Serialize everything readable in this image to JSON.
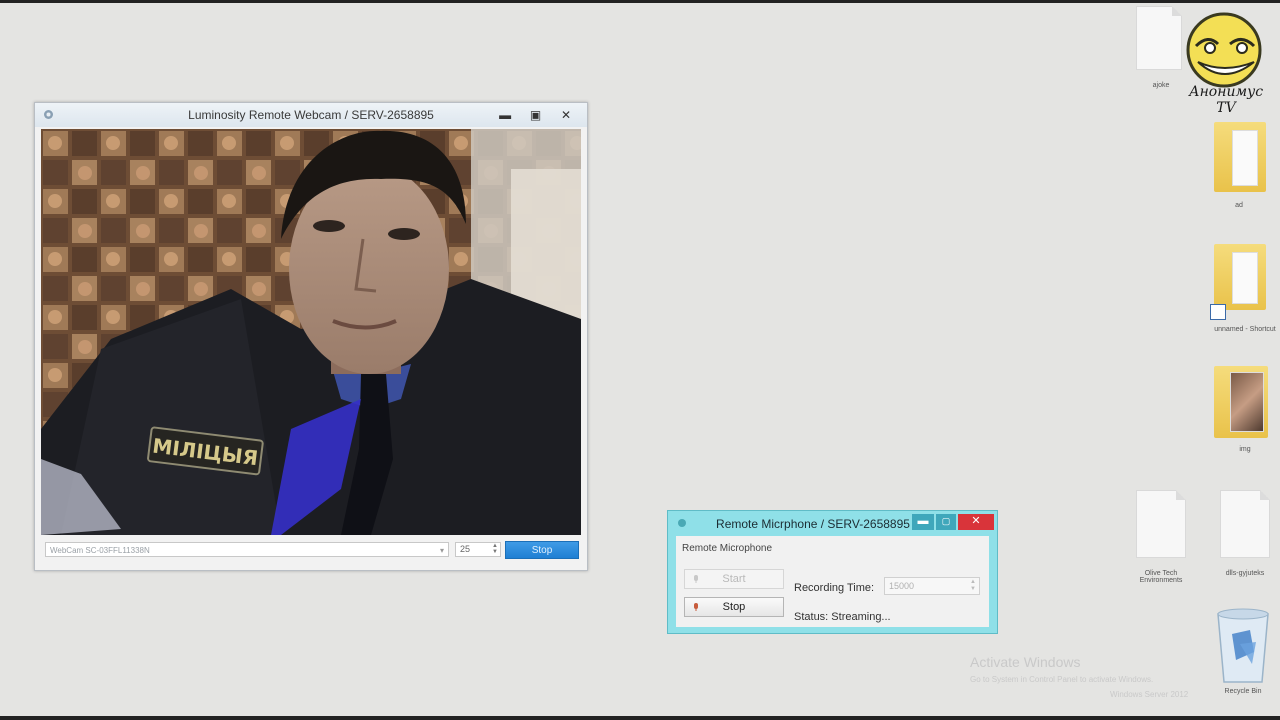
{
  "webcam_window": {
    "title": "Luminosity Remote Webcam / SERV-2658895",
    "device_select": "WebCam SC-03FFL11338N",
    "fps_value": "25",
    "stop_label": "Stop",
    "badge_text": "МІЛІЦЫЯ"
  },
  "mic_window": {
    "title": "Remote Micrphone / SERV-2658895",
    "group_label": "Remote Microphone",
    "start_label": "Start",
    "stop_label": "Stop",
    "recording_time_label": "Recording Time:",
    "recording_time_value": "15000",
    "status_text": "Status: Streaming..."
  },
  "desktop": {
    "logo_text": "Анонимус TV",
    "icons": [
      {
        "label": "ajoke"
      },
      {
        "label": "ad"
      },
      {
        "label": "unnamed - Shortcut"
      },
      {
        "label": "img"
      },
      {
        "label": "Olive Tech Environments"
      },
      {
        "label": "dlls-gyjuteks"
      },
      {
        "label": "Recycle Bin"
      }
    ],
    "activate_title": "Activate Windows",
    "activate_sub": "Go to System in Control Panel to activate Windows.",
    "build_text": "Windows Server 2012"
  },
  "colors": {
    "desktop_bg": "#e4e4e2",
    "mic_frame": "#8fe0e8",
    "cam_stop_button": "#1f7fd3",
    "close_button": "#d9343a"
  }
}
